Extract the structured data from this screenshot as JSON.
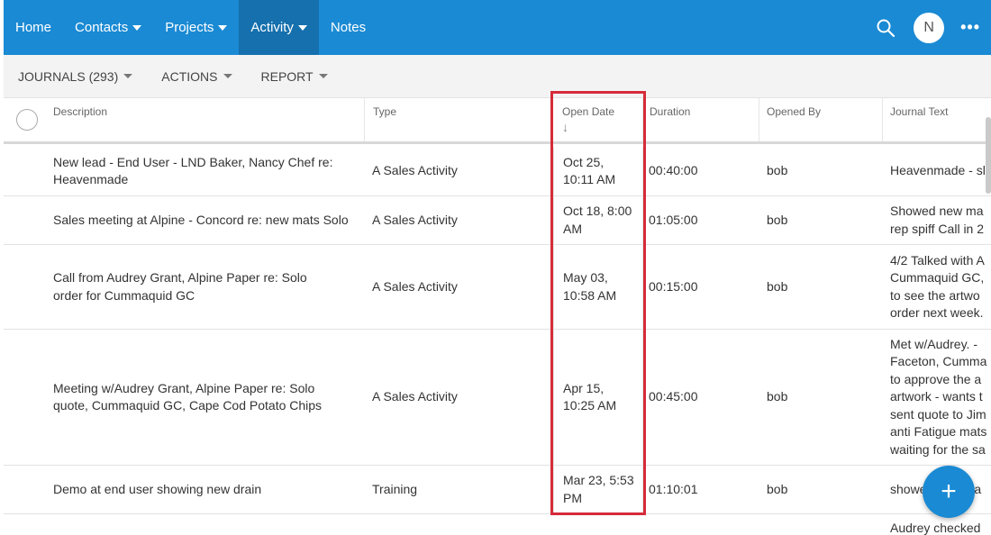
{
  "nav": {
    "items": [
      {
        "label": "Home",
        "dropdown": false,
        "active": false
      },
      {
        "label": "Contacts",
        "dropdown": true,
        "active": false
      },
      {
        "label": "Projects",
        "dropdown": true,
        "active": false
      },
      {
        "label": "Activity",
        "dropdown": true,
        "active": true
      },
      {
        "label": "Notes",
        "dropdown": false,
        "active": false
      }
    ],
    "avatar_initial": "N",
    "more_label": "•••"
  },
  "toolbar": {
    "journals": "JOURNALS (293)",
    "actions": "ACTIONS",
    "report": "REPORT"
  },
  "table": {
    "headers": {
      "description": "Description",
      "type": "Type",
      "open_date": "Open Date",
      "duration": "Duration",
      "opened_by": "Opened By",
      "journal_text": "Journal Text"
    },
    "sort_indicator": "↓",
    "rows": [
      {
        "description": "New lead - End User - LND Baker, Nancy Chef re: Heavenmade",
        "type": "A Sales Activity",
        "open_date": "Oct 25, 10:11 AM",
        "duration": "00:40:00",
        "opened_by": "bob",
        "journal_text": "Heavenmade - sl"
      },
      {
        "description": "Sales meeting at Alpine - Concord re: new mats Solo",
        "type": "A Sales Activity",
        "open_date": "Oct 18, 8:00 AM",
        "duration": "01:05:00",
        "opened_by": "bob",
        "journal_text": "Showed new ma\nrep spiff Call in 2"
      },
      {
        "description": "Call from Audrey Grant, Alpine Paper re: Solo order for Cummaquid GC",
        "type": "A Sales Activity",
        "open_date": "May 03, 10:58 AM",
        "duration": "00:15:00",
        "opened_by": "bob",
        "journal_text": "4/2 Talked with A\nCummaquid GC,\nto see the artwo\norder next week."
      },
      {
        "description": "Meeting w/Audrey Grant, Alpine Paper re: Solo quote, Cummaquid GC, Cape Cod Potato Chips",
        "type": "A Sales Activity",
        "open_date": "Apr 15, 10:25 AM",
        "duration": "00:45:00",
        "opened_by": "bob",
        "journal_text": "Met w/Audrey. -\nFaceton, Cumma\nto approve the a\nartwork - wants t\nsent quote to Jim\nanti Fatigue mats\nwaiting for the sa"
      },
      {
        "description": "Demo at end user showing new drain",
        "type": "Training",
        "open_date": "Mar 23, 5:53 PM",
        "duration": "01:10:01",
        "opened_by": "bob",
        "journal_text": "showed new tha"
      },
      {
        "description": "",
        "type": "",
        "open_date": "",
        "duration": "",
        "opened_by": "",
        "journal_text": "Audrey checked"
      }
    ]
  },
  "fab_label": "+",
  "colors": {
    "nav_bg": "#1a8ad4",
    "nav_active": "#1570ad",
    "highlight": "#d62b3a"
  }
}
